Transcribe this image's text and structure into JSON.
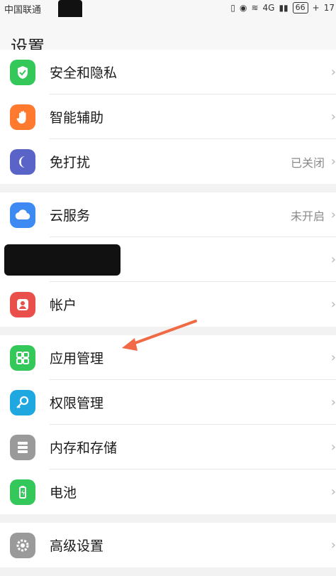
{
  "status_bar": {
    "carrier": "中国联通",
    "network": "4G",
    "battery": "66",
    "time": "17"
  },
  "header": {
    "title": "设置"
  },
  "groups": [
    {
      "items": [
        {
          "label": "安全和隐私",
          "icon": "shield-icon",
          "color": "#34c759"
        },
        {
          "label": "智能辅助",
          "icon": "hand-icon",
          "color": "#ff7a2f"
        },
        {
          "label": "免打扰",
          "icon": "moon-icon",
          "color": "#5a63c7",
          "value": "已关闭"
        }
      ]
    },
    {
      "items": [
        {
          "label": "云服务",
          "icon": "cloud-icon",
          "color": "#3d8bf2",
          "value": "未开启"
        },
        {
          "label": "",
          "icon": "redacted",
          "color": "#000000"
        },
        {
          "label": "帐户",
          "icon": "account-icon",
          "color": "#e9504b"
        }
      ]
    },
    {
      "items": [
        {
          "label": "应用管理",
          "icon": "apps-grid-icon",
          "color": "#34c759"
        },
        {
          "label": "权限管理",
          "icon": "key-icon",
          "color": "#1fa8e0"
        },
        {
          "label": "内存和存储",
          "icon": "storage-icon",
          "color": "#9a9a9a"
        },
        {
          "label": "电池",
          "icon": "battery-icon",
          "color": "#34c759"
        }
      ]
    },
    {
      "items": [
        {
          "label": "高级设置",
          "icon": "gear-icon",
          "color": "#9a9a9a"
        }
      ]
    }
  ],
  "annotation": {
    "color": "#f06b45",
    "target": "应用管理"
  }
}
